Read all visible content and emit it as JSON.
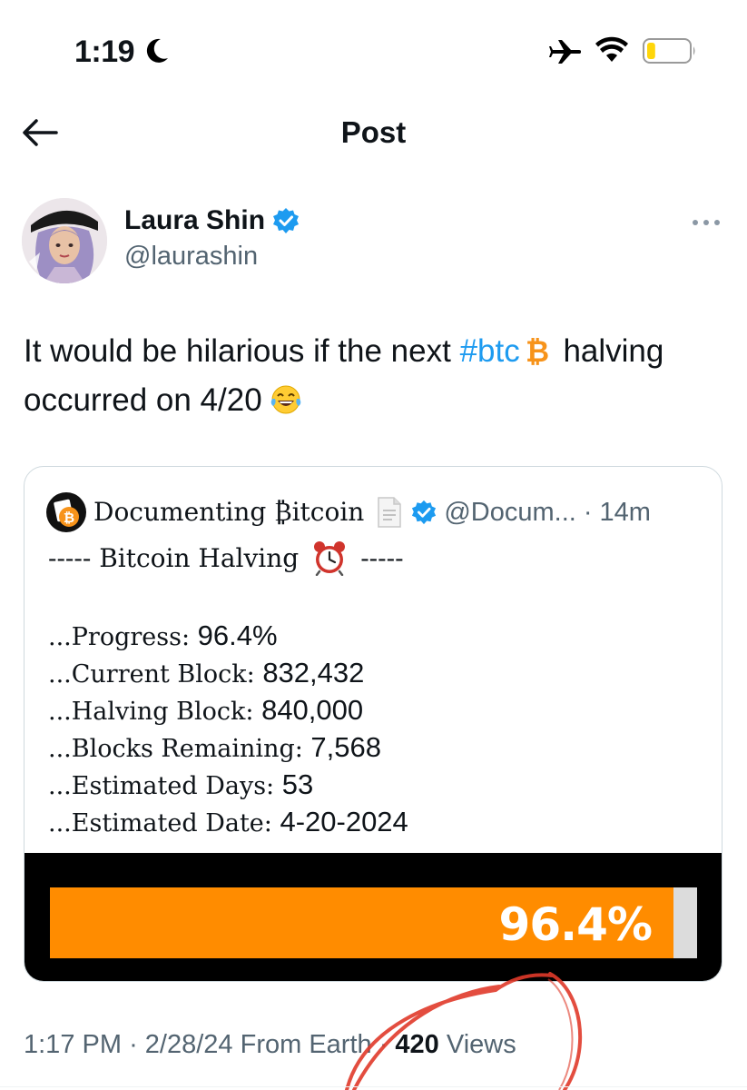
{
  "status_bar": {
    "time": "1:19",
    "battery_level": 0.2,
    "icons": [
      "moon-icon",
      "airplane-mode-icon",
      "wifi-icon",
      "battery-icon"
    ]
  },
  "header": {
    "title": "Post",
    "back_icon": "back-arrow-icon"
  },
  "author": {
    "name": "Laura Shin",
    "handle": "@laurashin",
    "verified": true
  },
  "post": {
    "text_before": "It would be hilarious if the next ",
    "hashtag": "#btc",
    "text_mid": " halving",
    "text_line2": "occurred on 4/20"
  },
  "quote": {
    "name": "Documenting ₿itcoin",
    "handle": "@Docum...",
    "time": "14m",
    "halving_line_left": "----- Bitcoin Halving",
    "halving_line_right": "-----",
    "stats": [
      {
        "label": "...Progress: ",
        "value": "96.4%"
      },
      {
        "label": "...Current Block: ",
        "value": "832,432"
      },
      {
        "label": "...Halving Block: ",
        "value": "840,000"
      },
      {
        "label": "...Blocks Remaining: ",
        "value": "7,568"
      },
      {
        "label": "...Estimated Days: ",
        "value": "53"
      },
      {
        "label": "...Estimated Date: ",
        "value": "4-20-2024"
      }
    ],
    "progress_label": "96.4%",
    "progress_fraction": 0.964
  },
  "meta": {
    "time": "1:17 PM",
    "date": "2/28/24",
    "source": "From Earth",
    "views_count": "420",
    "views_label": "Views"
  },
  "colors": {
    "accent": "#1d9bf0",
    "bitcoin_orange": "#f7931a",
    "progress_orange": "#ff8c00",
    "annotation_red": "#e03a2a"
  }
}
